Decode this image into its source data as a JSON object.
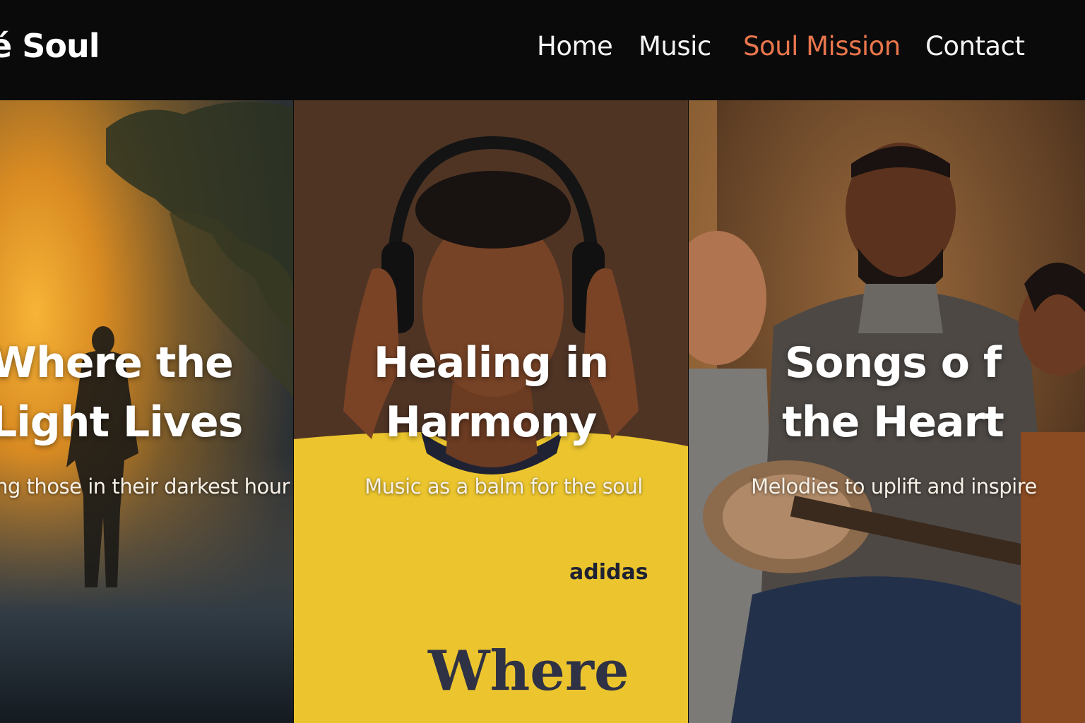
{
  "header": {
    "brand": "é Soul",
    "nav": [
      {
        "label": "Home",
        "active": false
      },
      {
        "label": "Music",
        "active": false
      },
      {
        "label": "Soul Mission",
        "active": true
      },
      {
        "label": "Contact",
        "active": false
      }
    ]
  },
  "panels": [
    {
      "title_line1": "Where the",
      "title_line2": "Light Lives",
      "subtitle": "ing those in their darkest hour"
    },
    {
      "title_line1": "Healing in",
      "title_line2": "Harmony",
      "subtitle": "Music as a balm for the soul",
      "shirt_brand": "adidas",
      "shirt_text": "Where"
    },
    {
      "title_line1": "Songs o f",
      "title_line2": "the Heart",
      "subtitle": "Melodies to uplift and inspire"
    }
  ],
  "colors": {
    "accent": "#e9764c",
    "header_bg": "#0a0a0a",
    "text": "#ffffff"
  }
}
